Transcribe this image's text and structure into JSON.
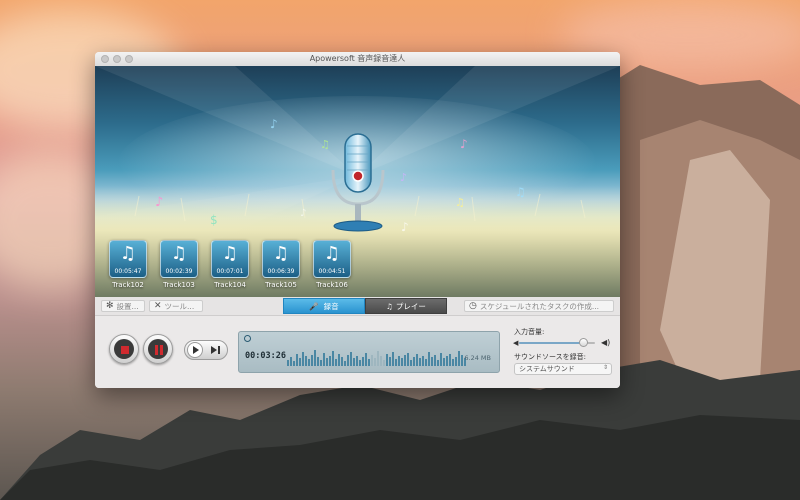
{
  "window": {
    "title": "Apowersoft 音声録音達人"
  },
  "tracks": [
    {
      "name": "Track102",
      "duration": "00:05:47"
    },
    {
      "name": "Track103",
      "duration": "00:02:39"
    },
    {
      "name": "Track104",
      "duration": "00:07:01"
    },
    {
      "name": "Track105",
      "duration": "00:06:39"
    },
    {
      "name": "Track106",
      "duration": "00:04:51"
    }
  ],
  "toolbar": {
    "settings_label": "設置...",
    "tools_label": "ツール...",
    "record_tab_label": "録音",
    "play_tab_label": "プレイー",
    "schedule_label": "スケジュールされたタスクの作成..."
  },
  "recorder": {
    "elapsed": "00:03:26",
    "file_size": "6.24 MB"
  },
  "audio": {
    "input_volume_label": "入力音量:",
    "input_volume_level": 0.86,
    "source_label": "サウンドソースを録音:",
    "source_value": "システムサウンド"
  },
  "icons": {
    "settings": "gear-icon",
    "tools": "wrench-icon",
    "record_tab": "microphone-icon",
    "play_tab": "music-note-icon",
    "schedule": "clock-icon",
    "stop": "stop-icon",
    "pause": "pause-icon",
    "play_next": "play-next-icon",
    "timer": "clock-icon",
    "volume_low": "speaker-low-icon",
    "volume_high": "speaker-high-icon",
    "track": "music-note-icon"
  },
  "colors": {
    "accent": "#2f9bd6",
    "record_button_inner": "#c0262b",
    "active_tab": "#3aa6de"
  }
}
